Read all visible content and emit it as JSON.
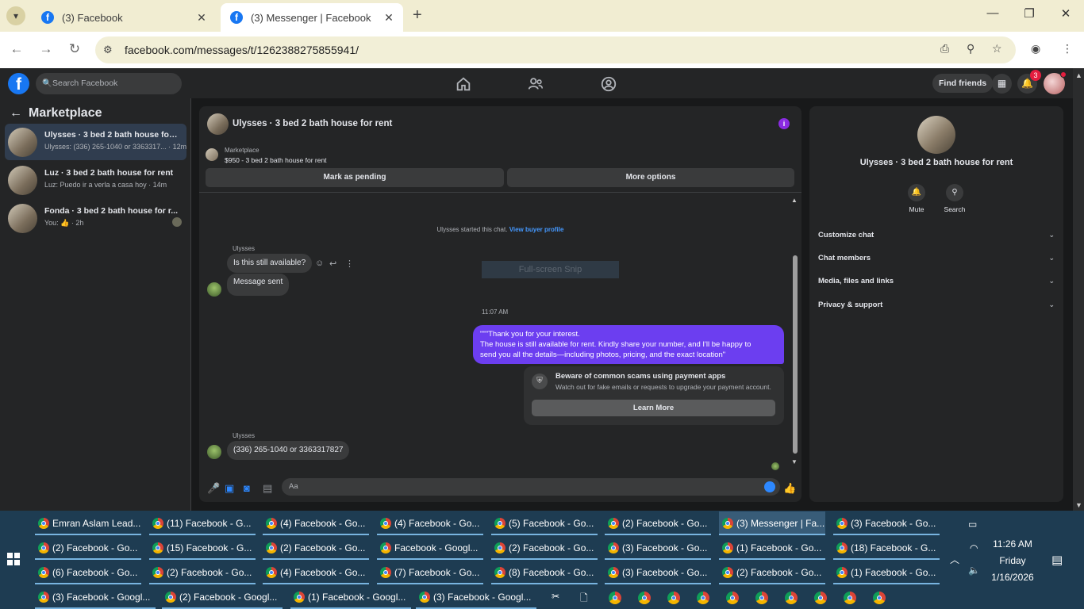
{
  "browser": {
    "tabs": [
      {
        "title": "(3) Facebook",
        "active": false
      },
      {
        "title": "(3) Messenger | Facebook",
        "active": true
      }
    ],
    "url": "facebook.com/messages/t/1262388275855941/"
  },
  "fb": {
    "search_placeholder": "Search Facebook",
    "find_friends": "Find friends",
    "notif_count": "3"
  },
  "sidebar": {
    "title": "Marketplace",
    "conversations": [
      {
        "name": "Ulysses · 3 bed 2 bath house for rent",
        "preview": "Ulysses: (336) 265-1040 or 3363317... · 12m",
        "active": true
      },
      {
        "name": "Luz · 3 bed 2 bath house for rent",
        "preview": "Luz: Puedo ir a verla a casa hoy · 14m",
        "active": false
      },
      {
        "name": "Fonda · 3 bed 2 bath house for r...",
        "preview": "You: 👍 · 2h",
        "active": false
      }
    ]
  },
  "chat": {
    "title": "Ulysses · 3 bed 2 bath house for rent",
    "listing_label": "Marketplace",
    "listing_price": "$950 - 3 bed 2 bath house for rent",
    "mark_pending": "Mark as pending",
    "more_options": "More options",
    "system_msg": "Ulysses started this chat.",
    "system_link": "View buyer profile",
    "sender": "Ulysses",
    "msg1": "Is this still available?",
    "msg2": "Message sent",
    "snip_overlay": "Full-screen Snip",
    "timestamp": "11:07 AM",
    "out_lines": [
      "\"\"\"Thank you for your interest.",
      "The house is still available for rent. Kindly share your number, and I'll be happy to",
      "send you all the details—including photos, pricing, and the exact location\""
    ],
    "scam_title": "Beware of common scams using payment apps",
    "scam_body": "Watch out for fake emails or requests to upgrade your payment account.",
    "learn_more": "Learn More",
    "sender2": "Ulysses",
    "msg3": "(336) 265-1040 or 3363317827",
    "composer_placeholder": "Aa"
  },
  "info": {
    "title": "Ulysses · 3 bed 2 bath house for rent",
    "mute": "Mute",
    "search": "Search",
    "sections": [
      "Customize chat",
      "Chat members",
      "Media, files and links",
      "Privacy & support"
    ]
  },
  "taskbar": {
    "items": [
      "Emran Aslam Lead...",
      "(11) Facebook - G...",
      "(4) Facebook - Go...",
      "(4) Facebook - Go...",
      "(5) Facebook - Go...",
      "(2) Facebook - Go...",
      "(3) Messenger | Fa...",
      "(3) Facebook - Go...",
      "(2) Facebook - Go...",
      "(15) Facebook - G...",
      "(2) Facebook - Go...",
      "Facebook - Googl...",
      "(2) Facebook - Go...",
      "(3) Facebook - Go...",
      "(1) Facebook - Go...",
      "(18) Facebook - G...",
      "(6) Facebook - Go...",
      "(2) Facebook - Go...",
      "(4) Facebook - Go...",
      "(7) Facebook - Go...",
      "(8) Facebook - Go...",
      "(3) Facebook - Go...",
      "(2) Facebook - Go...",
      "(1) Facebook - Go..."
    ],
    "row4": [
      "(3) Facebook - Googl...",
      "(2) Facebook - Googl...",
      "(1) Facebook - Googl...",
      "(3) Facebook - Googl..."
    ],
    "active_index": 6,
    "clock_time": "11:26 AM",
    "clock_day": "Friday",
    "clock_date": "1/16/2026"
  }
}
